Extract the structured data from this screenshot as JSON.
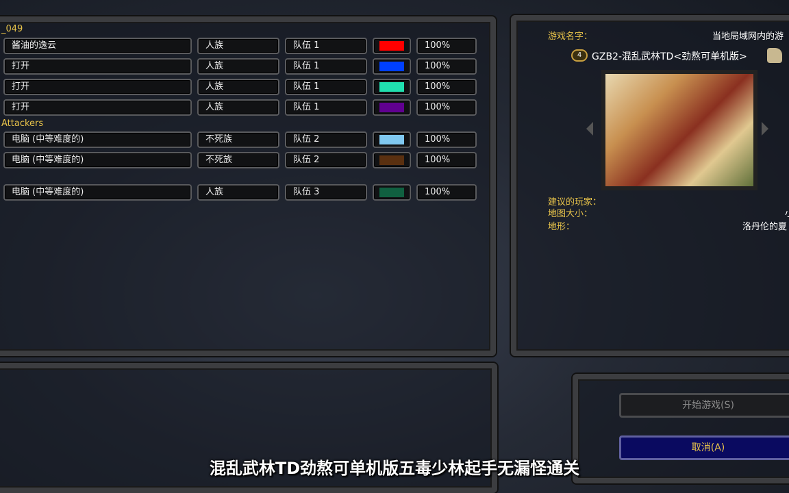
{
  "teams": [
    {
      "label": "_049",
      "players": [
        {
          "name": "酱油的逸云",
          "race": "人族",
          "team": "队伍 1",
          "color": "#ff0000",
          "handicap": "100%"
        },
        {
          "name": "打开",
          "race": "人族",
          "team": "队伍 1",
          "color": "#0040ff",
          "handicap": "100%"
        },
        {
          "name": "打开",
          "race": "人族",
          "team": "队伍 1",
          "color": "#20e0b0",
          "handicap": "100%"
        },
        {
          "name": "打开",
          "race": "人族",
          "team": "队伍 1",
          "color": "#600090",
          "handicap": "100%"
        }
      ]
    },
    {
      "label": "Attackers",
      "players": [
        {
          "name": "电脑 (中等难度的)",
          "race": "不死族",
          "team": "队伍 2",
          "color": "#80c8f0",
          "handicap": "100%"
        },
        {
          "name": "电脑 (中等难度的)",
          "race": "不死族",
          "team": "队伍 2",
          "color": "#5a3010",
          "handicap": "100%"
        }
      ]
    },
    {
      "label": "",
      "players": [
        {
          "name": "电脑 (中等难度的)",
          "race": "人族",
          "team": "队伍 3",
          "color": "#106040",
          "handicap": "100%"
        }
      ]
    }
  ],
  "game_info": {
    "game_name_label": "游戏名字：",
    "game_name_value": "当地局域网内的游",
    "player_count_badge": "4",
    "map_name": "GZB2-混乱武林TD<劲熬可单机版>",
    "suggested_players_label": "建议的玩家：",
    "map_size_label": "地图大小：",
    "map_size_value": "小",
    "terrain_label": "地形：",
    "terrain_value": "洛丹伦的夏"
  },
  "buttons": {
    "start": "开始游戏(S)",
    "cancel": "取消(A)"
  },
  "subtitle": "混乱武林TD劲熬可单机版五毒少林起手无漏怪通关"
}
